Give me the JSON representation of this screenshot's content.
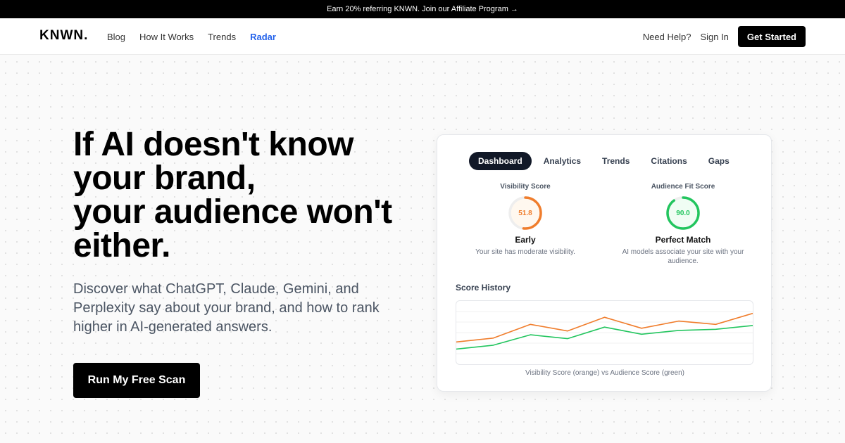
{
  "banner": {
    "text": "Earn 20% referring KNWN. Join our Affiliate Program →"
  },
  "nav": {
    "logo": "KNWN.",
    "links": [
      "Blog",
      "How It Works",
      "Trends",
      "Radar"
    ],
    "active_link": "Radar",
    "help": "Need Help?",
    "signin": "Sign In",
    "cta": "Get Started"
  },
  "hero": {
    "title_lines": [
      "If AI doesn't know",
      "your brand,",
      "your audience won't",
      "either."
    ],
    "subtitle": "Discover what ChatGPT, Claude, Gemini, and Perplexity say about your brand, and how to rank higher in AI-generated answers.",
    "cta": "Run My Free Scan"
  },
  "dashboard": {
    "tabs": [
      "Dashboard",
      "Analytics",
      "Trends",
      "Citations",
      "Gaps"
    ],
    "active_tab": "Dashboard",
    "visibility": {
      "label": "Visibility Score",
      "value": 51.8,
      "display": "51.8",
      "max": 100,
      "status": "Early",
      "description": "Your site has moderate visibility.",
      "color": "#f07d2c"
    },
    "audience": {
      "label": "Audience Fit Score",
      "value": 90.0,
      "display": "90.0",
      "max": 100,
      "status": "Perfect Match",
      "description": "AI models associate your site with your audience.",
      "color": "#22c55e"
    },
    "history_title": "Score History",
    "caption": "Visibility Score (orange) vs Audience Score (green)"
  },
  "chart_data": {
    "type": "line",
    "title": "Score History",
    "xlabel": "",
    "ylabel": "",
    "ylim": [
      0,
      100
    ],
    "grid": true,
    "series": [
      {
        "color": "#f07d2c",
        "values": [
          33,
          40,
          65,
          53,
          78,
          58,
          71,
          65,
          85
        ]
      },
      {
        "color": "#22c55e",
        "values": [
          20,
          27,
          46,
          39,
          60,
          47,
          54,
          56,
          63
        ]
      }
    ]
  },
  "colors": {
    "accent_link": "#2563eb",
    "primary_button": "#000000",
    "active_tab": "#111827"
  }
}
